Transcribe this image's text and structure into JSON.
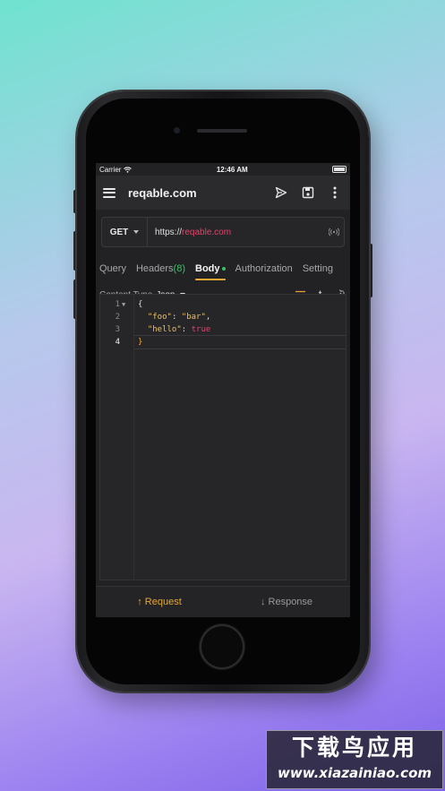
{
  "status": {
    "carrier": "Carrier",
    "time": "12:46 AM"
  },
  "appbar": {
    "title": "reqable.com"
  },
  "request": {
    "method": "GET",
    "url_scheme": "https://",
    "url_host": "reqable.com"
  },
  "tabs": [
    {
      "label": "Query"
    },
    {
      "label": "Headers",
      "count": "(8)"
    },
    {
      "label": "Body"
    },
    {
      "label": "Authorization"
    },
    {
      "label": "Setting"
    }
  ],
  "body": {
    "content_type_label": "Content Type",
    "content_type_value": "Json"
  },
  "editor": {
    "line_numbers": [
      "1",
      "2",
      "3",
      "4"
    ],
    "line1": "{",
    "line2_key": "\"foo\"",
    "line2_sep": ": ",
    "line2_val": "\"bar\"",
    "line2_end": ",",
    "line3_key": "\"hello\"",
    "line3_sep": ": ",
    "line3_val": "true",
    "line4": "}"
  },
  "bottom": {
    "request": "↑ Request",
    "response": "↓ Response"
  },
  "watermark": {
    "cn": "下载鸟应用",
    "en": "www.xiazainiao.com"
  },
  "colors": {
    "accent": "#e7a735",
    "url_host": "#e0436a",
    "count": "#3cbf6a",
    "background": "#222224"
  }
}
